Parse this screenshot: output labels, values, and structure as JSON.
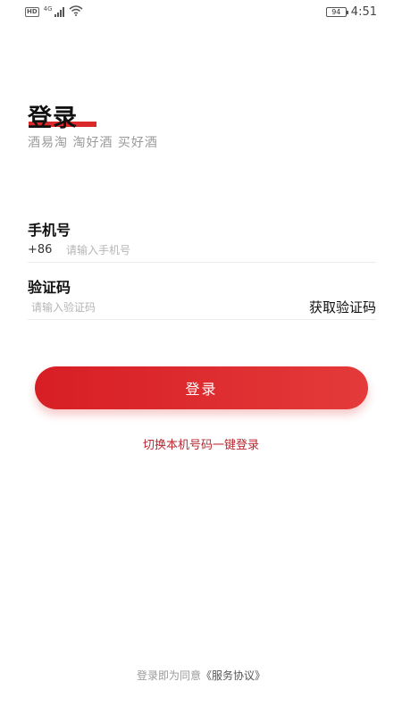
{
  "status_bar": {
    "hd_badge": "HD",
    "network": "4G",
    "battery": "94",
    "time": "4:51"
  },
  "header": {
    "title": "登录",
    "subtitle": "酒易淘 淘好酒 买好酒"
  },
  "form": {
    "phone_label": "手机号",
    "country_code": "+86",
    "phone_placeholder": "请输入手机号",
    "phone_value": "",
    "code_label": "验证码",
    "code_placeholder": "请输入验证码",
    "code_value": "",
    "get_code_label": "获取验证码"
  },
  "actions": {
    "login_label": "登录",
    "switch_label": "切换本机号码一键登录"
  },
  "footer": {
    "agreement_prefix": "登录即为同意",
    "agreement_link": "《服务协议》"
  },
  "colors": {
    "accent": "#d9292a",
    "link": "#b8262e"
  }
}
